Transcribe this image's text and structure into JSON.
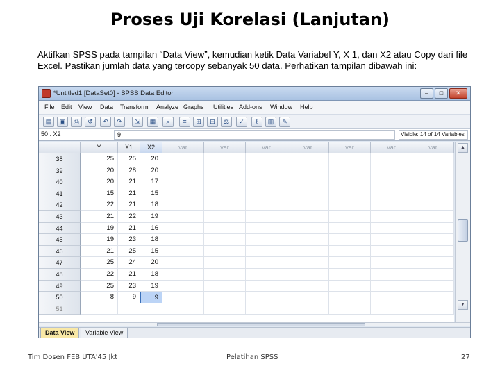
{
  "slide": {
    "title": "Proses Uji Korelasi (Lanjutan)",
    "description": "Aktifkan SPSS pada tampilan “Data View”, kemudian ketik Data Variabel Y, X 1, dan X2 atau Copy dari file Excel. Pastikan jumlah data yang tercopy sebanyak 50 data. Perhatikan tampilan dibawah ini:",
    "footer_left": "Tim Dosen FEB UTA'45 Jkt",
    "footer_center": "Pelatihan SPSS",
    "page_number": "27"
  },
  "window": {
    "title": "*Untitled1 [DataSet0] - SPSS Data Editor",
    "buttons": {
      "minimize": "–",
      "maximize": "□",
      "close": "✕"
    }
  },
  "menu": [
    "File",
    "Edit",
    "View",
    "Data",
    "Transform",
    "Analyze",
    "Graphs",
    "Utilities",
    "Add-ons",
    "Window",
    "Help"
  ],
  "toolbar_icons": [
    "open-icon",
    "save-icon",
    "print-icon",
    "dialog-recall-icon",
    "undo-icon",
    "redo-icon",
    "goto-case-icon",
    "variables-icon",
    "find-icon",
    "insert-cases-icon",
    "insert-variable-icon",
    "split-file-icon",
    "weight-cases-icon",
    "select-cases-icon",
    "value-labels-icon",
    "use-sets-icon",
    "spell-check-icon"
  ],
  "cell_editor": {
    "reference": "50 : X2",
    "value": "9",
    "visible": "Visible: 14 of 14 Variables"
  },
  "grid": {
    "columns": [
      "Y",
      "X1",
      "X2",
      "var",
      "var",
      "var",
      "var",
      "var",
      "var",
      "var"
    ],
    "rows": [
      {
        "n": "38",
        "y": "25",
        "x1": "25",
        "x2": "20"
      },
      {
        "n": "39",
        "y": "20",
        "x1": "28",
        "x2": "20"
      },
      {
        "n": "40",
        "y": "20",
        "x1": "21",
        "x2": "17"
      },
      {
        "n": "41",
        "y": "15",
        "x1": "21",
        "x2": "15"
      },
      {
        "n": "42",
        "y": "22",
        "x1": "21",
        "x2": "18"
      },
      {
        "n": "43",
        "y": "21",
        "x1": "22",
        "x2": "19"
      },
      {
        "n": "44",
        "y": "19",
        "x1": "21",
        "x2": "16"
      },
      {
        "n": "45",
        "y": "19",
        "x1": "23",
        "x2": "18"
      },
      {
        "n": "46",
        "y": "21",
        "x1": "25",
        "x2": "15"
      },
      {
        "n": "47",
        "y": "25",
        "x1": "24",
        "x2": "20"
      },
      {
        "n": "48",
        "y": "22",
        "x1": "21",
        "x2": "18"
      },
      {
        "n": "49",
        "y": "25",
        "x1": "23",
        "x2": "19"
      },
      {
        "n": "50",
        "y": "8",
        "x1": "9",
        "x2": "9"
      },
      {
        "n": "51",
        "y": "",
        "x1": "",
        "x2": ""
      }
    ],
    "selected_row": 12,
    "selected_col": 2
  },
  "tabs": [
    "Data View",
    "Variable View"
  ],
  "colors": {
    "selection": "#bcd4f6",
    "active_tab": "#f9e8a6",
    "titlebar": "#a9c2e2"
  }
}
